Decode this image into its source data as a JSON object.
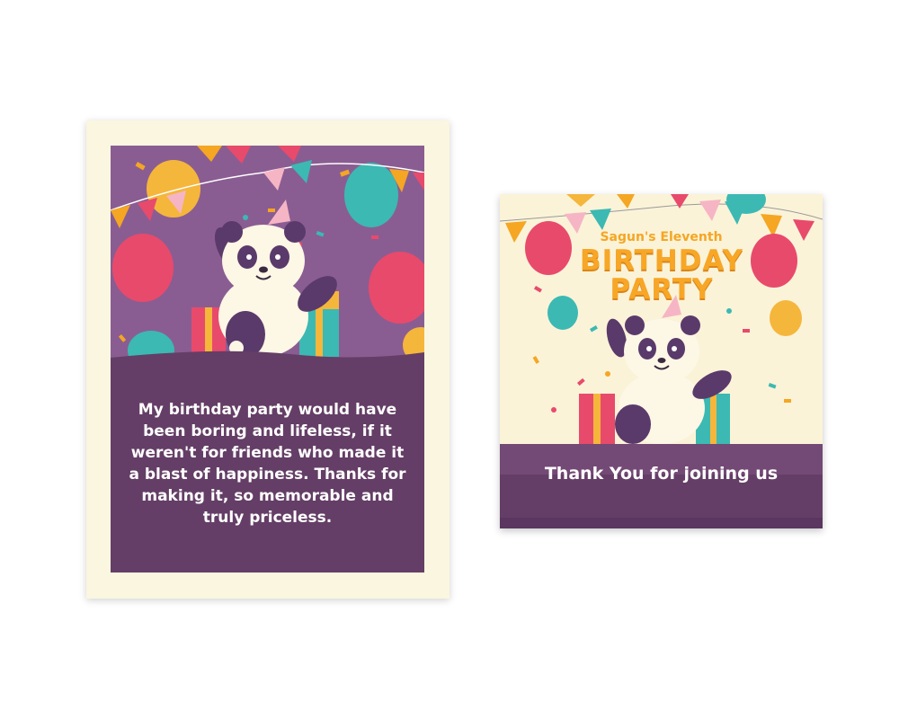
{
  "left_card": {
    "message": "My birthday party would have been boring and lifeless, if it weren't for friends who made it a blast of happiness. Thanks for making it, so memorable and truly priceless."
  },
  "right_card": {
    "title_small": "Sagun's Eleventh",
    "title_line1": "BIRTHDAY",
    "title_line2": "PARTY",
    "thanks": "Thank You for joining us"
  },
  "colors": {
    "purple_dark": "#643e66",
    "purple_light": "#8a5d92",
    "cream": "#fbf6e0",
    "orange": "#f7a626"
  },
  "icons": [
    "panda-icon",
    "balloon-icon",
    "gift-icon",
    "bunting-icon",
    "party-hat-icon",
    "confetti-icon"
  ]
}
